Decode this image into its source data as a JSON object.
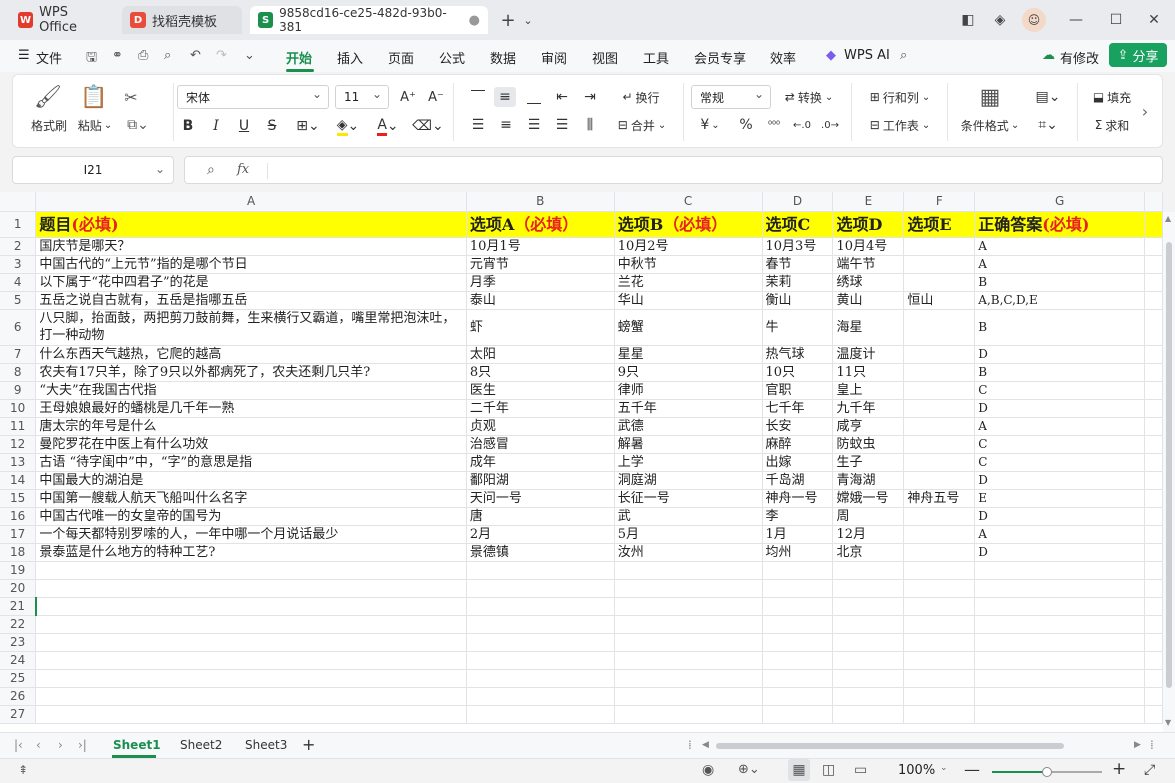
{
  "window": {
    "tabs": [
      {
        "label": "WPS Office",
        "icon": "wps-logo-icon"
      },
      {
        "label": "找稻壳模板",
        "icon": "docer-icon"
      },
      {
        "label": "9858cd16-ce25-482d-93b0-381",
        "icon": "spreadsheet-icon"
      }
    ],
    "new_tab": "+",
    "controls": [
      "minimize-icon",
      "maximize-icon",
      "close-icon"
    ]
  },
  "menubar": {
    "file": "文件",
    "items": [
      "开始",
      "插入",
      "页面",
      "公式",
      "数据",
      "审阅",
      "视图",
      "工具",
      "会员专享",
      "效率"
    ],
    "active": "开始",
    "wps_ai": "WPS AI",
    "modify": "有修改",
    "share": "分享"
  },
  "ribbon": {
    "format_painter": "格式刷",
    "paste": "粘贴",
    "font_name": "宋体",
    "font_size": "11",
    "wrap": "换行",
    "merge": "合并",
    "number_format": "常规",
    "convert": "转换",
    "row_col": "行和列",
    "worksheet": "工作表",
    "cond_format": "条件格式",
    "fill": "填充",
    "sum": "求和",
    "currency": "¥",
    "percent": "%"
  },
  "formula": {
    "cell_ref": "I21",
    "fx": "fx",
    "value": ""
  },
  "grid": {
    "columns": [
      "A",
      "B",
      "C",
      "D",
      "E",
      "F",
      "G"
    ],
    "header_row": [
      {
        "text": "题目",
        "req": "(必填)"
      },
      {
        "text": "选项A",
        "req": "（必填）"
      },
      {
        "text": "选项B",
        "req": "（必填）"
      },
      {
        "text": "选项C",
        "req": ""
      },
      {
        "text": "选项D",
        "req": ""
      },
      {
        "text": "选项E",
        "req": ""
      },
      {
        "text": "正确答案",
        "req": "(必填)"
      }
    ],
    "rows": [
      [
        "国庆节是哪天？",
        "10月1号",
        "10月2号",
        "10月3号",
        "10月4号",
        "",
        "A"
      ],
      [
        "中国古代的“上元节”指的是哪个节日",
        "元宵节",
        "中秋节",
        "春节",
        "端午节",
        "",
        "A"
      ],
      [
        "以下属于“花中四君子”的花是",
        "月季",
        "兰花",
        "茉莉",
        "绣球",
        "",
        "B"
      ],
      [
        "五岳之说自古就有，五岳是指哪五岳",
        "泰山",
        "华山",
        "衡山",
        "黄山",
        "恒山",
        "A,B,C,D,E"
      ],
      [
        "八只脚，抬面鼓，两把剪刀鼓前舞，生来横行又霸道，嘴里常把泡沫吐，打一种动物",
        "虾",
        "螃蟹",
        "牛",
        "海星",
        "",
        "B"
      ],
      [
        "什么东西天气越热，它爬的越高",
        "太阳",
        "星星",
        "热气球",
        "温度计",
        "",
        "D"
      ],
      [
        "农夫有17只羊，除了9只以外都病死了，农夫还剩几只羊?",
        "8只",
        "9只",
        "10只",
        "11只",
        "",
        "B"
      ],
      [
        "“大夫”在我国古代指",
        "医生",
        "律师",
        "官职",
        "皇上",
        "",
        "C"
      ],
      [
        "王母娘娘最好的蟠桃是几千年一熟",
        "二千年",
        "五千年",
        "七千年",
        "九千年",
        "",
        "D"
      ],
      [
        "唐太宗的年号是什么",
        "贞观",
        "武德",
        "长安",
        "咸亨",
        "",
        "A"
      ],
      [
        "曼陀罗花在中医上有什么功效",
        "治感冒",
        "解暑",
        "麻醉",
        "防蚊虫",
        "",
        "C"
      ],
      [
        "古语 “待字闺中”中，“字”的意思是指",
        "成年",
        "上学",
        "出嫁",
        "生子",
        "",
        "C"
      ],
      [
        "中国最大的湖泊是",
        "鄱阳湖",
        "洞庭湖",
        "千岛湖",
        "青海湖",
        "",
        "D"
      ],
      [
        "中国第一艘载人航天飞船叫什么名字",
        "天问一号",
        "长征一号",
        "神舟一号",
        "嫦娥一号",
        "神舟五号",
        "E"
      ],
      [
        "中国古代唯一的女皇帝的国号为",
        "唐",
        "武",
        "李",
        "周",
        "",
        "D"
      ],
      [
        "一个每天都特别罗嗦的人，一年中哪一个月说话最少",
        "2月",
        "5月",
        "1月",
        "12月",
        "",
        "A"
      ],
      [
        "景泰蓝是什么地方的特种工艺?",
        "景德镇",
        "汝州",
        "均州",
        "北京",
        "",
        "D"
      ]
    ],
    "row_numbers": [
      "1",
      "2",
      "3",
      "4",
      "5",
      "6",
      "7",
      "8",
      "9",
      "10",
      "11",
      "12",
      "13",
      "14",
      "15",
      "16",
      "17",
      "18",
      "19",
      "20",
      "21",
      "22",
      "23",
      "24",
      "25",
      "26",
      "27"
    ],
    "selected_cell": "I21"
  },
  "sheets": {
    "tabs": [
      "Sheet1",
      "Sheet2",
      "Sheet3"
    ],
    "active": "Sheet1",
    "add": "+"
  },
  "status": {
    "zoom": "100%",
    "zoom_fraction": 0.5
  },
  "colors": {
    "accent": "#1a8f4e",
    "header_fill": "#ffff00",
    "required_text": "#e8211e"
  }
}
